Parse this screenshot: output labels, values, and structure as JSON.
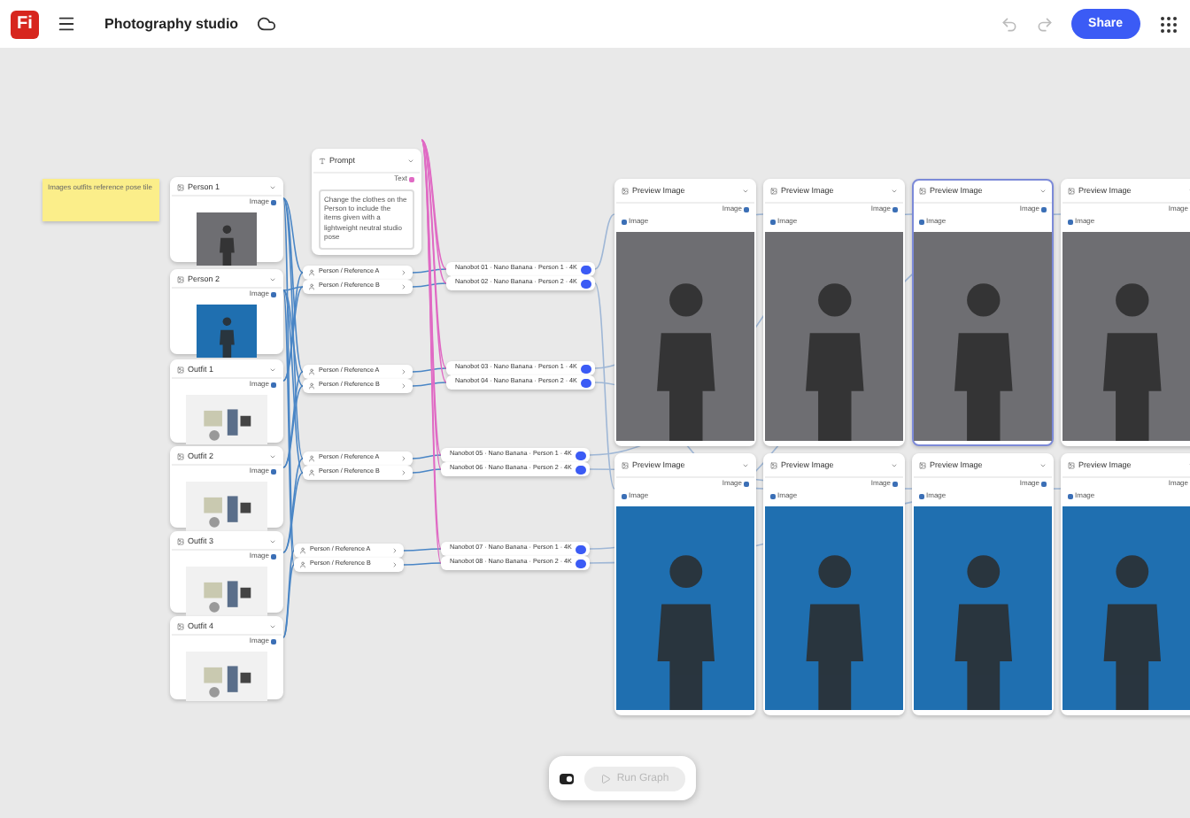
{
  "top_bar": {
    "logo": "Fi",
    "title": "Photography studio",
    "share": "Share",
    "undo_disabled": true,
    "redo_disabled": true
  },
  "sticky_note": {
    "text": "Images outfits reference pose tile"
  },
  "inputs": [
    {
      "title": "Person 1",
      "port": "Image",
      "kind": "gray-backdrop"
    },
    {
      "title": "Person 2",
      "port": "Image",
      "kind": "blue-backdrop"
    },
    {
      "title": "Outfit 1",
      "port": "Image",
      "kind": "flatlay"
    },
    {
      "title": "Outfit 2",
      "port": "Image",
      "kind": "flatlay"
    },
    {
      "title": "Outfit 3",
      "port": "Image",
      "kind": "flatlay"
    },
    {
      "title": "Outfit 4",
      "port": "Image",
      "kind": "flatlay"
    }
  ],
  "prompt": {
    "title": "Prompt",
    "port": "Text",
    "text": "Change the clothes on the Person to include the items given with a lightweight neutral studio pose"
  },
  "references": [
    {
      "label": "Person / Reference A"
    },
    {
      "label": "Person / Reference B"
    },
    {
      "label": "Person / Reference A"
    },
    {
      "label": "Person / Reference B"
    },
    {
      "label": "Person / Reference A"
    },
    {
      "label": "Person / Reference B"
    },
    {
      "label": "Person / Reference A"
    },
    {
      "label": "Person / Reference B"
    }
  ],
  "generators": [
    {
      "label": "Nanobot 01 · Nano Banana · Person 1 · 4K",
      "on": true
    },
    {
      "label": "Nanobot 02 · Nano Banana · Person 2 · 4K",
      "on": true
    },
    {
      "label": "Nanobot 03 · Nano Banana · Person 1 · 4K",
      "on": true
    },
    {
      "label": "Nanobot 04 · Nano Banana · Person 2 · 4K",
      "on": true
    },
    {
      "label": "Nanobot 05 · Nano Banana · Person 1 · 4K",
      "on": true
    },
    {
      "label": "Nanobot 06 · Nano Banana · Person 2 · 4K",
      "on": true
    },
    {
      "label": "Nanobot 07 · Nano Banana · Person 1 · 4K",
      "on": true
    },
    {
      "label": "Nanobot 08 · Nano Banana · Person 2 · 4K",
      "on": true
    }
  ],
  "previews": [
    {
      "title": "Preview Image",
      "output": "Image",
      "input": "Image",
      "kind": "gray-backdrop",
      "selected": false
    },
    {
      "title": "Preview Image",
      "output": "Image",
      "input": "Image",
      "kind": "gray-backdrop",
      "selected": false
    },
    {
      "title": "Preview Image",
      "output": "Image",
      "input": "Image",
      "kind": "gray-backdrop",
      "selected": true
    },
    {
      "title": "Preview Image",
      "output": "Image",
      "input": "Image",
      "kind": "gray-backdrop",
      "selected": false
    },
    {
      "title": "Preview Image",
      "output": "Image",
      "input": "Image",
      "kind": "blue-backdrop",
      "selected": false
    },
    {
      "title": "Preview Image",
      "output": "Image",
      "input": "Image",
      "kind": "blue-backdrop",
      "selected": false
    },
    {
      "title": "Preview Image",
      "output": "Image",
      "input": "Image",
      "kind": "blue-backdrop",
      "selected": false
    },
    {
      "title": "Preview Image",
      "output": "Image",
      "input": "Image",
      "kind": "blue-backdrop",
      "selected": false
    }
  ],
  "run_bar": {
    "run": "Run Graph",
    "disabled": true
  }
}
